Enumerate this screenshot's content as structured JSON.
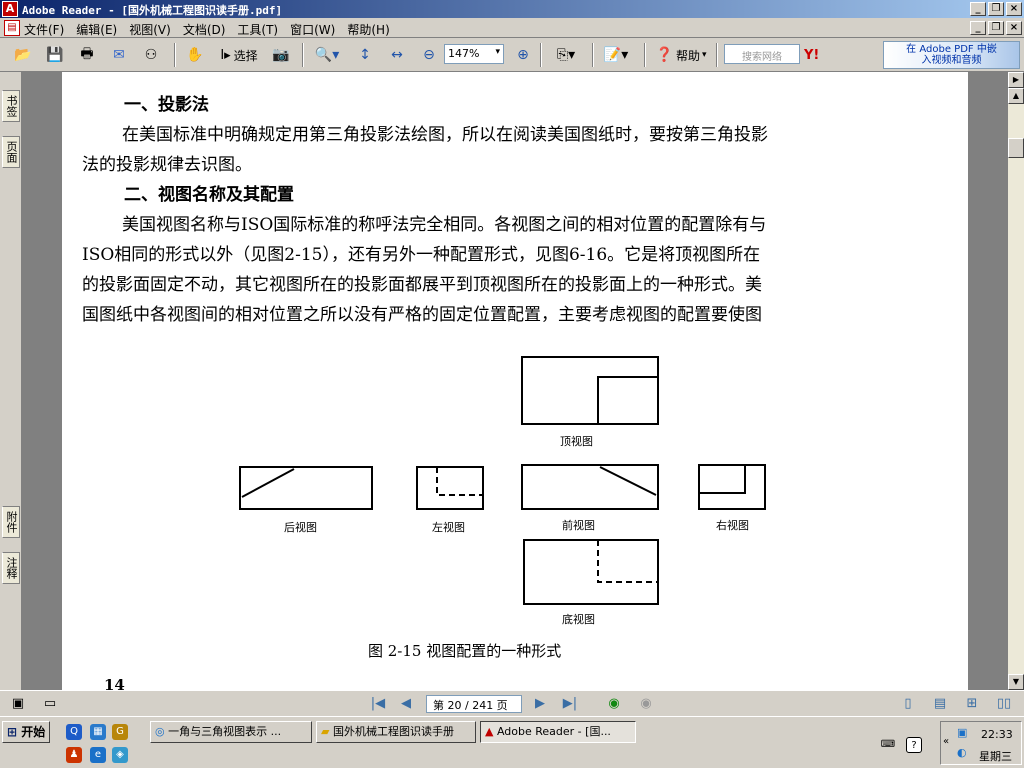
{
  "window": {
    "title": "Adobe Reader - [国外机械工程图识读手册.pdf]"
  },
  "menu": {
    "items": [
      "文件(F)",
      "编辑(E)",
      "视图(V)",
      "文档(D)",
      "工具(T)",
      "窗口(W)",
      "帮助(H)"
    ]
  },
  "toolbar": {
    "select_label": "选择",
    "zoom_value": "147%",
    "help_label": "帮助",
    "search_placeholder": "搜索网络",
    "promo_line1": "在 Adobe PDF 中嵌",
    "promo_line2": "入视频和音频"
  },
  "leftnav": {
    "tabs": [
      "书签",
      "页面",
      "附件",
      "注释"
    ]
  },
  "document": {
    "heading1": "一、投影法",
    "para1_line1": "在美国标准中明确规定用第三角投影法绘图，所以在阅读美国图纸时，要按第三角投影",
    "para1_line2": "法的投影规律去识图。",
    "heading2": "二、视图名称及其配置",
    "para2_line1": "美国视图名称与ISO国际标准的称呼法完全相同。各视图之间的相对位置的配置除有与",
    "para2_line2": "ISO相同的形式以外（见图2-15），还有另外一种配置形式，见图6-16。它是将顶视图所在",
    "para2_line3": "的投影面固定不动，其它视图所在的投影面都展平到顶视图所在的投影面上的一种形式。美",
    "para2_line4": "国图纸中各视图间的相对位置之所以没有严格的固定位置配置，主要考虑视图的配置要使图",
    "figure": {
      "top": "顶视图",
      "rear": "后视图",
      "left": "左视图",
      "front": "前视图",
      "right": "右视图",
      "bottom": "底视图",
      "caption": "图 2-15   视图配置的一种形式"
    },
    "page_number": "14"
  },
  "pagenav": {
    "page_display": "第 20 / 241 页"
  },
  "taskbar": {
    "start_label": "开始",
    "tasks": [
      "一角与三角视图表示 ...",
      "国外机械工程图识读手册",
      "Adobe Reader - [国..."
    ],
    "clock": "22:33",
    "weekday": "星期三"
  },
  "colors": {
    "titlebar_start": "#0a246a",
    "titlebar_end": "#a6caf0",
    "chrome": "#d4d0c8",
    "doc_bg": "#808080"
  }
}
